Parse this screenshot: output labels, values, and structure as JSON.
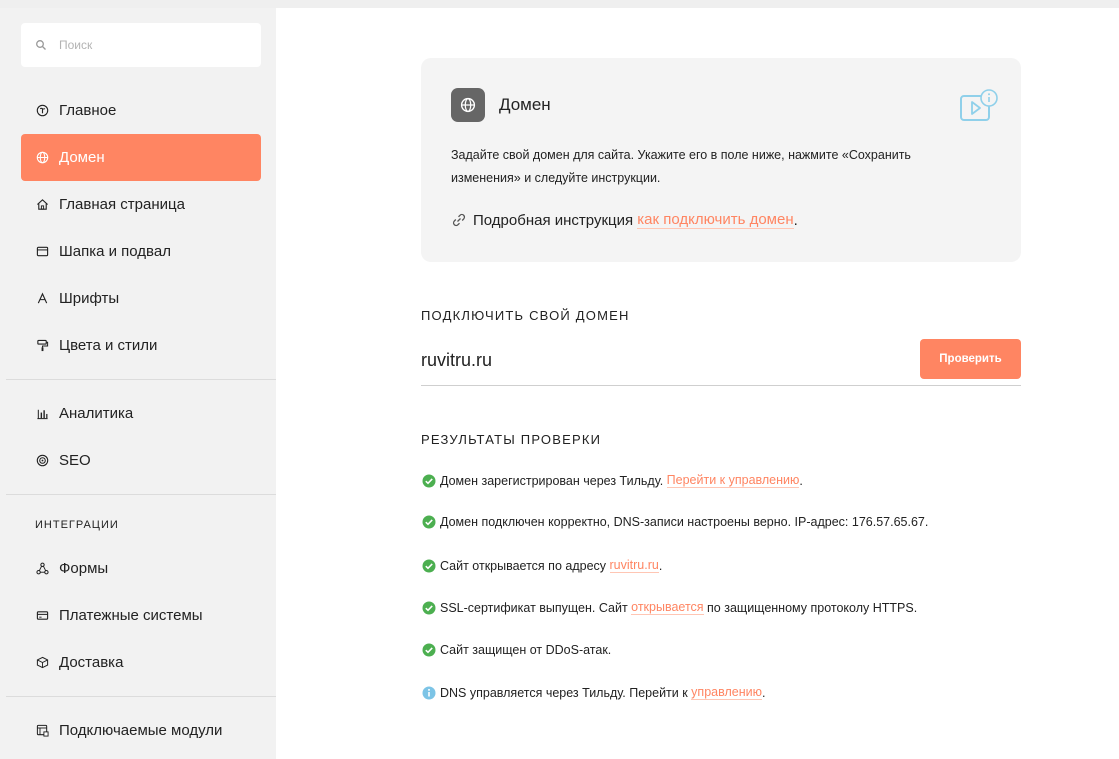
{
  "sidebar": {
    "search_placeholder": "Поиск",
    "items": [
      {
        "label": "Главное",
        "icon": "tilda-logo-icon"
      },
      {
        "label": "Домен",
        "icon": "globe-icon",
        "active": true
      },
      {
        "label": "Главная страница",
        "icon": "home-icon"
      },
      {
        "label": "Шапка и подвал",
        "icon": "window-icon"
      },
      {
        "label": "Шрифты",
        "icon": "font-icon"
      },
      {
        "label": "Цвета и стили",
        "icon": "paint-roller-icon"
      },
      {
        "label": "Аналитика",
        "icon": "bar-chart-icon"
      },
      {
        "label": "SEO",
        "icon": "target-icon"
      },
      {
        "label": "Формы",
        "icon": "forms-nodes-icon"
      },
      {
        "label": "Платежные системы",
        "icon": "card-icon"
      },
      {
        "label": "Доставка",
        "icon": "box-icon"
      },
      {
        "label": "Подключаемые модули",
        "icon": "modules-icon"
      }
    ],
    "integrations_label": "ИНТЕГРАЦИИ"
  },
  "info_card": {
    "title": "Домен",
    "description": "Задайте свой домен для сайта. Укажите его в поле ниже, нажмите «Сохранить изменения» и следуйте инструкции.",
    "instruction_prefix": "Подробная инструкция ",
    "instruction_link": "как подключить домен",
    "instruction_suffix": "."
  },
  "connect": {
    "label": "ПОДКЛЮЧИТЬ СВОЙ ДОМЕН",
    "domain_value": "ruvitru.ru",
    "button_label": "Проверить"
  },
  "results": {
    "label": "РЕЗУЛЬТАТЫ ПРОВЕРКИ",
    "items": [
      {
        "status": "ok",
        "text": "Домен зарегистрирован через Тильду. ",
        "link": "Перейти к управлению",
        "after": "."
      },
      {
        "status": "ok",
        "text": "Домен подключен корректно, DNS-записи настроены верно. IP-адрес: 176.57.65.67.",
        "link": "",
        "after": ""
      },
      {
        "status": "ok",
        "text": "Сайт открывается по адресу ",
        "link": "ruvitru.ru",
        "after": "."
      },
      {
        "status": "ok",
        "text": "SSL-сертификат выпущен. Сайт ",
        "link": "открывается",
        "after": " по защищенному протоколу HTTPS."
      },
      {
        "status": "ok",
        "text": "Сайт защищен от DDoS-атак.",
        "link": "",
        "after": ""
      },
      {
        "status": "info",
        "text": "DNS управляется через Тильду. Перейти к ",
        "link": "управлению",
        "after": "."
      }
    ]
  },
  "colors": {
    "accent": "#ff8562",
    "success": "#4caf50",
    "info": "#7cc4e6"
  }
}
